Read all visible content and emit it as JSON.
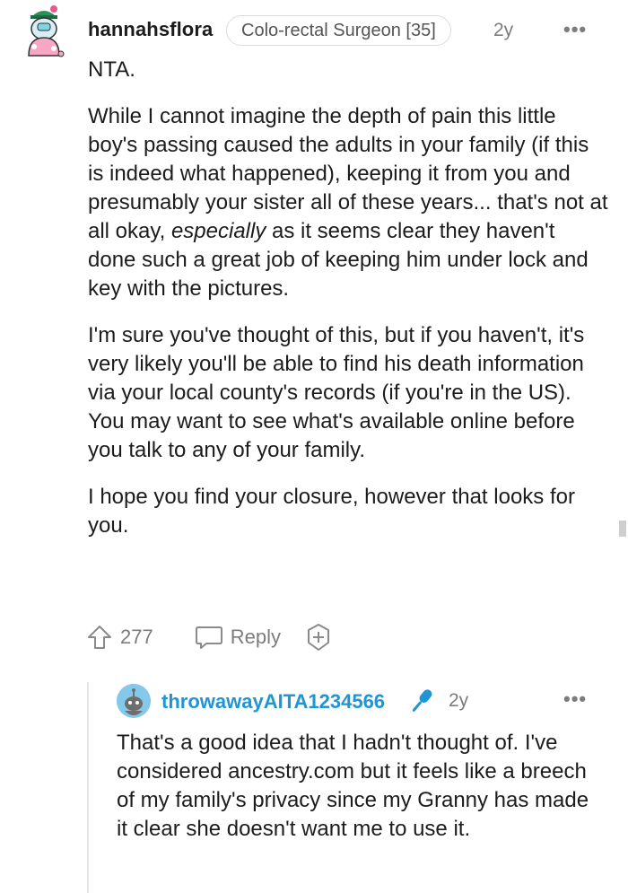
{
  "comment": {
    "username": "hannahsflora",
    "flair": "Colo-rectal Surgeon [35]",
    "age": "2y",
    "more": "•••",
    "paragraphs": [
      "NTA.",
      "While I cannot imagine the depth of pain this little boy's passing caused the adults in your family (if this is indeed what happened), keeping it from you and presumably your sister all of these years... that's not at all okay,",
      "as it seems clear they haven't done such a great job of keeping him under lock and key with the pictures.",
      "I'm sure you've thought of this, but if you haven't, it's very likely you'll be able to find his death information via your local county's records (if you're in the US). You may want to see what's available online before you talk to any of your family.",
      "I hope you find your closure, however that looks for you."
    ],
    "emphasis": "especially",
    "upvotes": "277",
    "reply_label": "Reply"
  },
  "reply": {
    "username": "throwawayAITA1234566",
    "age": "2y",
    "more": "•••",
    "text": "That's a good idea that I hadn't thought of. I've considered ancestry.com but it feels like a breech of my family's privacy since my Granny has made it clear she doesn't want me to use it."
  },
  "icons": {
    "upvote": "upvote-arrow-icon",
    "reply": "speech-bubble-icon",
    "award": "award-plus-icon",
    "op": "microphone-icon"
  },
  "colors": {
    "text": "#1c1c1c",
    "muted": "#7c7c7c",
    "reply_username": "#1f95d4",
    "op_icon": "#1f95d4"
  }
}
